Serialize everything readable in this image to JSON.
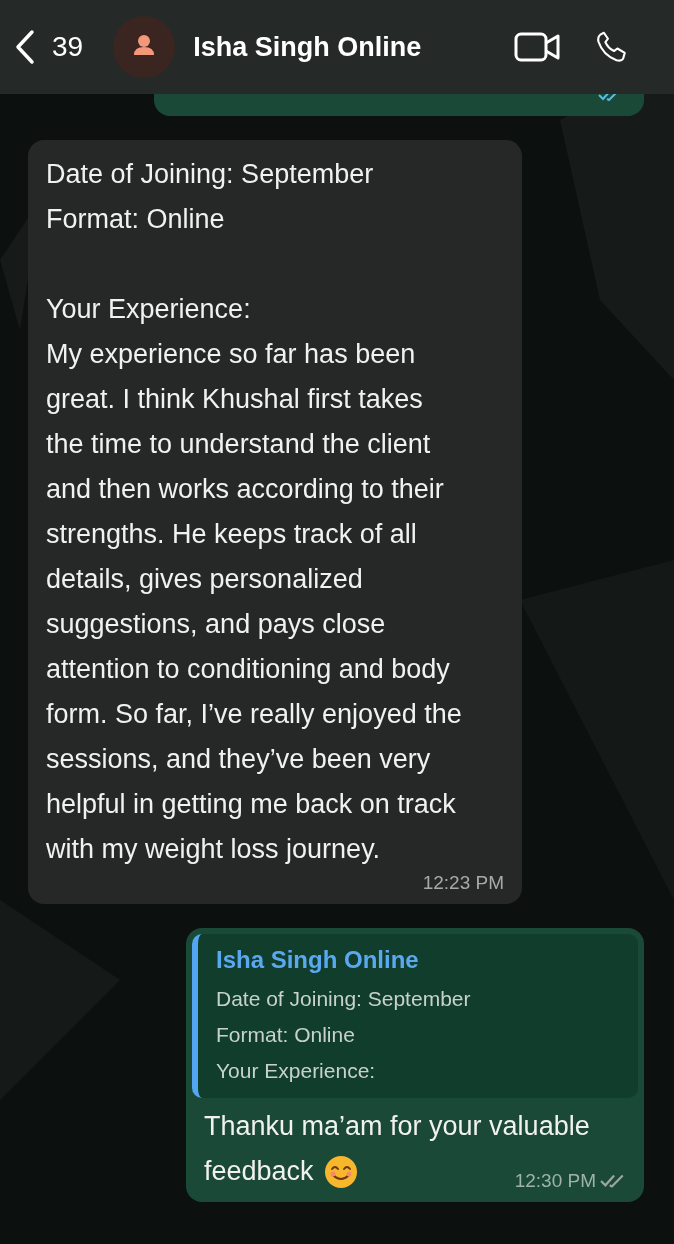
{
  "header": {
    "back_count": "39",
    "contact_name": "Isha Singh Online"
  },
  "messages": [
    {
      "kind": "cut",
      "read": true
    },
    {
      "kind": "text",
      "text": "Date of Joining: September\nFormat: Online\n\nYour Experience:\nMy experience so far has been\ngreat. I think Khushal first takes\nthe time to understand the client\nand then works according to their\nstrengths. He keeps track of all\ndetails, gives personalized\nsuggestions, and pays close\nattention to conditioning and body\nform. So far, I’ve really enjoyed the\nsessions, and they’ve been very\nhelpful in getting me back on track\nwith my weight loss journey.",
      "time": "12:23 PM"
    },
    {
      "kind": "reply",
      "read": false,
      "quote": {
        "author": "Isha Singh Online",
        "lines": [
          "Date of Joining: September",
          "Format: Online",
          "Your Experience:"
        ]
      },
      "text_lines": [
        "Thanku ma’am for your valuable",
        "feedback"
      ],
      "emoji": true,
      "time": "12:30 PM"
    }
  ]
}
